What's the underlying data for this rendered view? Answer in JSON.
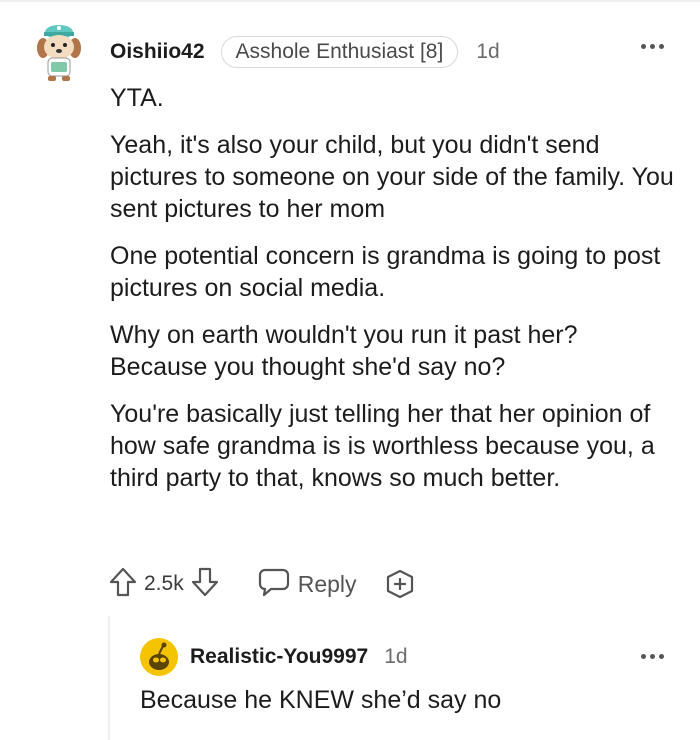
{
  "comment": {
    "username": "Oishiio42",
    "flair": "Asshole Enthusiast [8]",
    "time": "1d",
    "paragraphs": [
      "YTA.",
      "Yeah, it's also your child, but you didn't send pictures to someone on your side of the family. You sent pictures to her mom",
      "One potential concern is grandma is going to post pictures on social media.",
      "Why on earth wouldn't you run it past her? Because you thought she'd say no?",
      "You're basically just telling her that her opinion of how safe grandma is is worthless because you, a third party to that, knows so much better."
    ],
    "votes": "2.5k",
    "reply_label": "Reply"
  },
  "reply": {
    "username": "Realistic-You9997",
    "time": "1d",
    "text": "Because he KNEW she’d say no"
  },
  "icons": {
    "avatar": "dog-avatar-icon",
    "upvote": "arrow-up-icon",
    "downvote": "arrow-down-icon",
    "reply": "speech-bubble-icon",
    "award": "award-plus-icon",
    "more": "more-dots-icon",
    "reply_avatar": "snoo-avatar-icon"
  },
  "colors": {
    "accent_yellow": "#f5c400",
    "text": "#1c1c1c",
    "muted": "#6b6b6b"
  }
}
